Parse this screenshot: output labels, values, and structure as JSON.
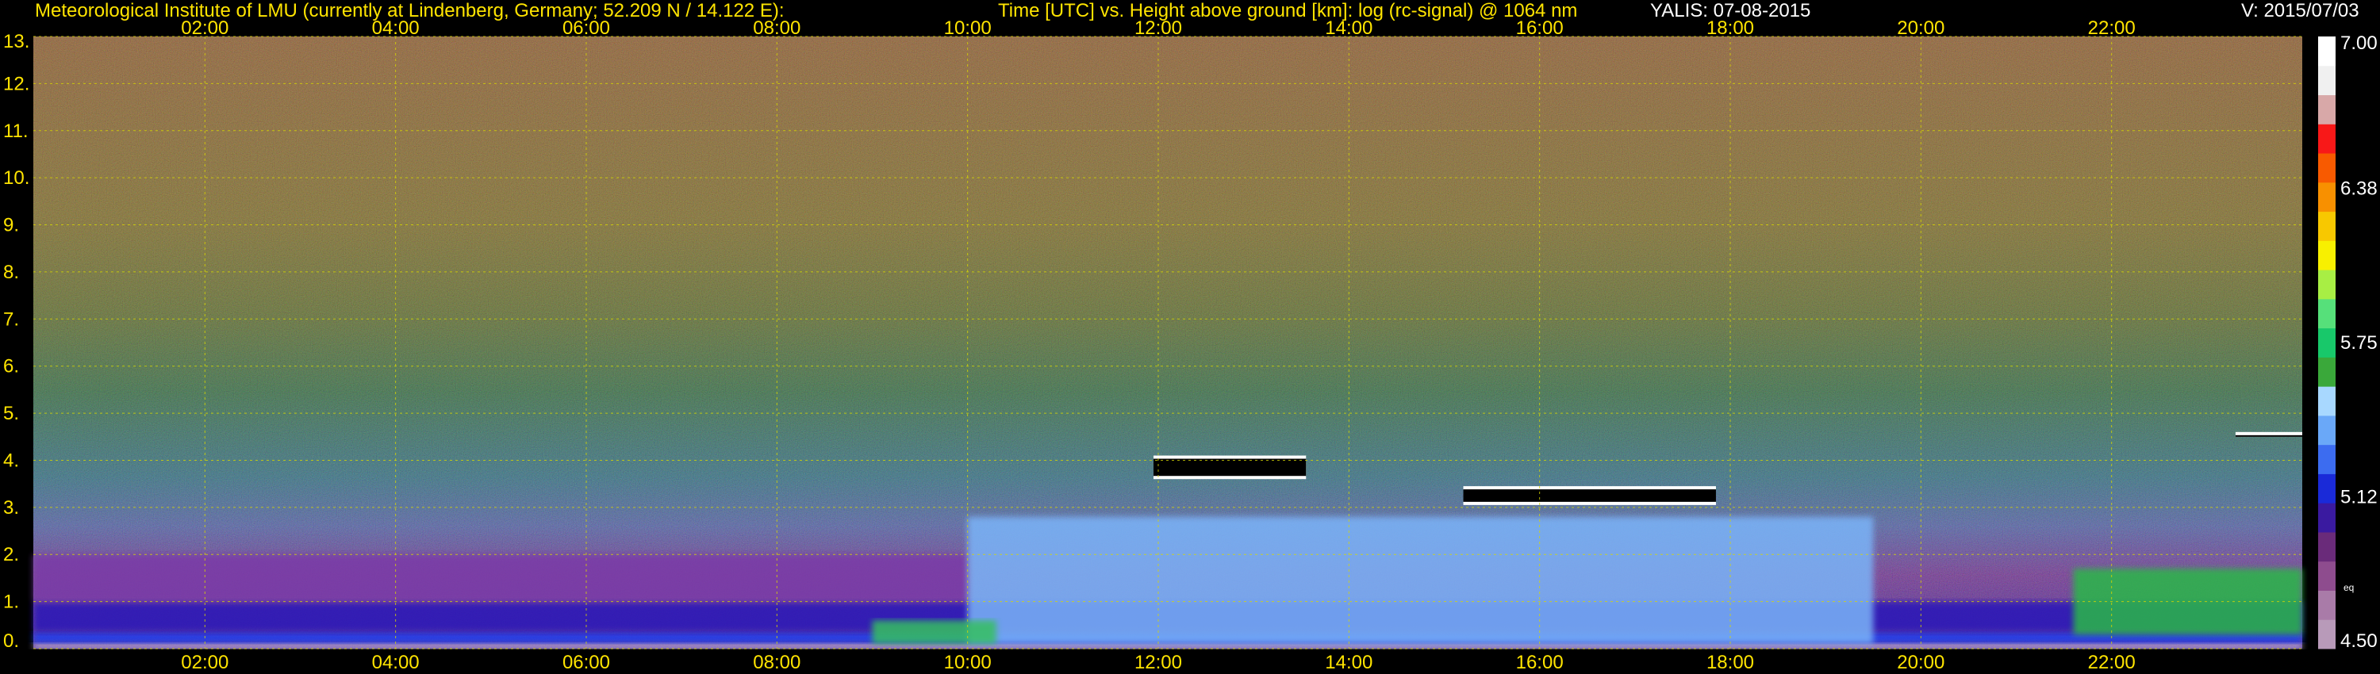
{
  "header": {
    "institute": "Meteorological Institute of LMU (currently at Lindenberg, Germany; 52.209 N / 14.122 E):",
    "plot_title": "Time [UTC] vs. Height above ground [km]: log (rc-signal) @ 1064 nm",
    "instrument_date": "YALIS: 07-08-2015",
    "version": "V: 2015/07/03"
  },
  "colors": {
    "header_text": "#ffe400",
    "tick_text": "#ffe400",
    "grid": "#d8d800",
    "white_text": "#ffffff"
  },
  "chart_data": {
    "type": "heatmap",
    "title": "Time [UTC] vs. Height above ground [km]: log (rc-signal) @ 1064 nm",
    "xlabel": "Time [UTC]",
    "ylabel": "Height above ground [km]",
    "x_ticks": [
      "02:00",
      "04:00",
      "06:00",
      "08:00",
      "10:00",
      "12:00",
      "14:00",
      "16:00",
      "18:00",
      "20:00",
      "22:00"
    ],
    "x_range_hours": [
      0.2,
      24.0
    ],
    "y_ticks": [
      "0.",
      "1.",
      "2.",
      "3.",
      "4.",
      "5.",
      "6.",
      "7.",
      "8.",
      "9.",
      "10.",
      "11.",
      "12.",
      "13."
    ],
    "y_range_km": [
      0,
      13
    ],
    "grid": true,
    "colorbar": {
      "range": [
        4.5,
        7.0
      ],
      "tick_labels": [
        "7.00",
        "6.38",
        "5.75",
        "5.12",
        "4.50"
      ],
      "tick_values": [
        7.0,
        6.38,
        5.75,
        5.12,
        4.5
      ],
      "extra_label": "eq",
      "colors": [
        "#b89ab9",
        "#a97ba8",
        "#8e4c8e",
        "#6a2b7a",
        "#3a1aa0",
        "#1a2ad8",
        "#3c6cf0",
        "#6aa8f8",
        "#a8d8ff",
        "#3aa83a",
        "#18c86a",
        "#56e07a",
        "#a8ee44",
        "#f8f000",
        "#f8c800",
        "#f89000",
        "#f85a00",
        "#f81818",
        "#d8a8a8",
        "#f0f0f0",
        "#ffffff"
      ]
    },
    "layers": [
      {
        "name": "ground",
        "x_start": 0.2,
        "x_end": 24.0,
        "bottom_km": 0.0,
        "top_km": 0.12,
        "color": "#c8b4d8"
      },
      {
        "name": "boundary_layer_core",
        "x_start": 0.2,
        "x_end": 24.0,
        "bottom_km": 0.12,
        "top_km": 0.35,
        "color": "#1a3cf0"
      },
      {
        "name": "boundary_layer_upper",
        "x_start": 0.2,
        "x_end": 24.0,
        "bottom_km": 0.35,
        "top_km": 1.0,
        "color": "#2a18b8"
      },
      {
        "name": "residual_layer",
        "x_start": 0.2,
        "x_end": 10.0,
        "bottom_km": 1.0,
        "top_km": 2.0,
        "color": "#7a3aa8"
      },
      {
        "name": "mixed_layer_day",
        "x_start": 10.0,
        "x_end": 19.5,
        "bottom_km": 0.1,
        "top_km": 2.8,
        "color": "#7ab4f8"
      },
      {
        "name": "mixing_green_morning",
        "x_start": 9.0,
        "x_end": 10.3,
        "bottom_km": 0.1,
        "top_km": 0.6,
        "color": "#34c060"
      },
      {
        "name": "evening_green",
        "x_start": 21.6,
        "x_end": 24.0,
        "bottom_km": 0.3,
        "top_km": 1.7,
        "color": "#2ab848"
      }
    ],
    "clouds": [
      {
        "x_start": 11.95,
        "x_end": 13.55,
        "bottom_km": 3.6,
        "top_km": 4.1
      },
      {
        "x_start": 15.2,
        "x_end": 17.85,
        "bottom_km": 3.05,
        "top_km": 3.45
      },
      {
        "x_start": 23.3,
        "x_end": 24.0,
        "bottom_km": 4.5,
        "top_km": 4.6
      }
    ]
  }
}
